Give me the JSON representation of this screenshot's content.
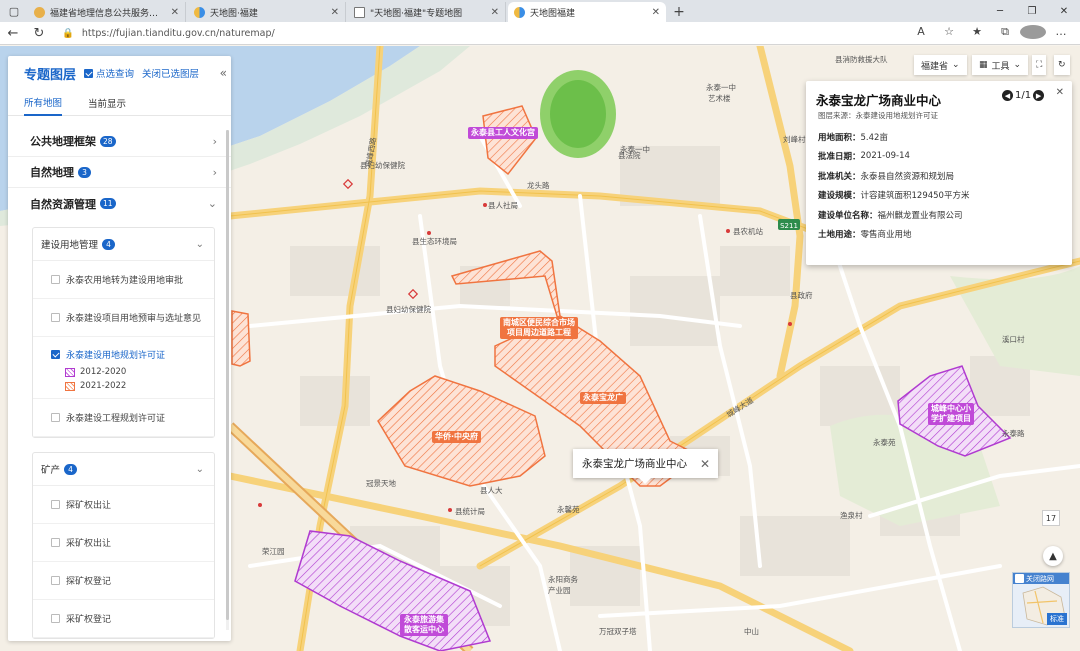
{
  "browser": {
    "tabs": [
      {
        "label": "福建省地理信息公共服务平台 天",
        "active": false
      },
      {
        "label": "天地图·福建",
        "active": false
      },
      {
        "label": "\"天地图·福建\"专题地图",
        "active": false
      },
      {
        "label": "天地图福建",
        "active": true
      }
    ],
    "url": "https://fujian.tianditu.gov.cn/naturemap/"
  },
  "panel": {
    "title": "专题图层",
    "point_query": "点选查询",
    "close_selected": "关闭已选图层",
    "tabs": [
      "所有地图",
      "当前显示"
    ],
    "sections": [
      {
        "label": "公共地理框架",
        "count": "28"
      },
      {
        "label": "自然地理",
        "count": "3"
      },
      {
        "label": "自然资源管理",
        "count": "11"
      }
    ],
    "construction": {
      "label": "建设用地管理",
      "count": "4",
      "items": [
        "永泰农用地转为建设用地审批",
        "永泰建设项目用地预审与选址意见",
        "永泰建设用地规划许可证",
        "永泰建设工程规划许可证"
      ],
      "legend": [
        "2012-2020",
        "2021-2022"
      ]
    },
    "mining": {
      "label": "矿产",
      "count": "4",
      "items": [
        "探矿权出让",
        "采矿权出让",
        "探矿权登记",
        "采矿权登记"
      ]
    }
  },
  "popup": {
    "title": "永泰宝龙广场商业中心",
    "pager": "1/1",
    "source": "图层来源：永泰建设用地规划许可证",
    "rows": [
      {
        "key": "用地面积：",
        "value": "5.42亩"
      },
      {
        "key": "批准日期：",
        "value": "2021-09-14"
      },
      {
        "key": "批准机关：",
        "value": "永泰县自然资源和规划局"
      },
      {
        "key": "建设规模：",
        "value": "计容建筑面积129450平方米"
      },
      {
        "key": "建设单位名称：",
        "value": "福州麒龙置业有限公司"
      },
      {
        "key": "土地用途：",
        "value": "零售商业用地"
      }
    ]
  },
  "map_popup": {
    "label": "永泰宝龙广场商业中心"
  },
  "controls": {
    "region": "福建省",
    "tools": "工具",
    "zoom": "17",
    "minimap_toggle": "关闭路网",
    "minimap_tag": "标准"
  },
  "area_labels": {
    "workers_palace": "永泰县工人文化宫",
    "south_city": "南城区便民综合市场项目周边道路工程",
    "baolong": "永泰宝龙广",
    "huaqiao": "华侨·中央府",
    "chengfeng": "城峰中心小学扩建项目",
    "tourism": "永泰旅游集散客运中心"
  },
  "pois": {
    "poi1": "县妇幼保健院",
    "poi2": "县人社局",
    "poi3": "县生态环境局",
    "poi4": "县妇幼保健院",
    "poi5": "龙头路",
    "poi6": "县农机站",
    "poi7": "县消防救援大队",
    "poi8": "永泰一中",
    "poi9": "永泰一中",
    "poi10": "艺术楼",
    "poi11": "县统计局",
    "poi12": "县人大",
    "poi13": "县政府",
    "poi14": "永馨苑",
    "poi15": "城峰大道",
    "poi16": "永阳商务产业园",
    "poi17": "城峰西路",
    "poi18": "刘峰村",
    "poi19": "永泰苑",
    "poi20": "溪口村",
    "poi21": "渔泉村",
    "poi22": "永泰路",
    "poi23": "万冠双子塔",
    "poi24": "中山",
    "poi25": "冠景天地",
    "poi26": "荣江园",
    "poi27": "县法院",
    "poi28": "S211"
  },
  "colors": {
    "accent": "#1a66c9",
    "orange": "#f07440",
    "purple": "#c04ad8",
    "river": "#b9d3ec"
  }
}
